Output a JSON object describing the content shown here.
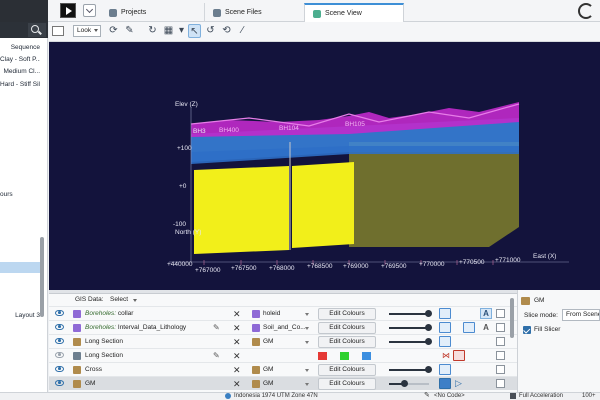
{
  "tabs": [
    {
      "label": "Projects"
    },
    {
      "label": "Scene Files"
    },
    {
      "label": "Scene View"
    }
  ],
  "sidebar": {
    "items": [
      {
        "label": "Sequence"
      },
      {
        "label": "Clay - Soft P..."
      },
      {
        "label": "Medium Cl..."
      },
      {
        "label": "Hard - Stiff Sil..."
      },
      {
        "label": "ours"
      },
      {
        "label": "Layout 3"
      }
    ]
  },
  "toolbar": {
    "look_label": "Look"
  },
  "scene": {
    "axis_elev": "Elev (Z)",
    "axis_north": "North (Y)",
    "axis_east": "East (X)",
    "borehole_labels": [
      "BH3",
      "BH400",
      "BH104",
      "BH105"
    ],
    "elev_ticks": [
      "+100",
      "+0",
      "-100"
    ],
    "east_ticks": [
      "+767000",
      "+767500",
      "+768000",
      "+768500",
      "+769000",
      "+769500",
      "+770000",
      "+770500",
      "+771000"
    ],
    "north_tick": "+440000",
    "colors": {
      "background": "#13133c",
      "yellow_layer": "#f2ef1a",
      "blue_layer": "#3a86e0",
      "magenta_layer": "#d32ad8"
    }
  },
  "bottom": {
    "gis_label": "GIS Data:",
    "gis_value": "Select",
    "rows": [
      {
        "name_prefix": "Boreholes:",
        "name": " collar",
        "property": "holeid",
        "edit": "Edit Colours"
      },
      {
        "name_prefix": "Boreholes:",
        "name": " Interval_Data_Lithology",
        "property": "Soil_and_Co...",
        "edit": "Edit Colours"
      },
      {
        "name_prefix": "",
        "name": "Long Section",
        "property": "GM",
        "edit": "Edit Colours"
      },
      {
        "name_prefix": "",
        "name": "Long Section",
        "property": "",
        "edit": ""
      },
      {
        "name_prefix": "",
        "name": "Cross",
        "property": "GM",
        "edit": "Edit Colours"
      },
      {
        "name_prefix": "",
        "name": "GM",
        "property": "GM",
        "edit": "Edit Colours"
      }
    ],
    "swatch_colors": [
      "#e53935",
      "#2ed12e",
      "#3c8fe0"
    ]
  },
  "right_panel": {
    "title": "GM",
    "slice_mode_label": "Slice mode:",
    "slice_mode_value": "From Scene",
    "fill_slicer_label": "Fill Slicer"
  },
  "status": {
    "crs": "Indonesia 1974 UTM Zone 47N",
    "code": "<No Code>",
    "accel": "Full Acceleration",
    "fps": "100+"
  }
}
